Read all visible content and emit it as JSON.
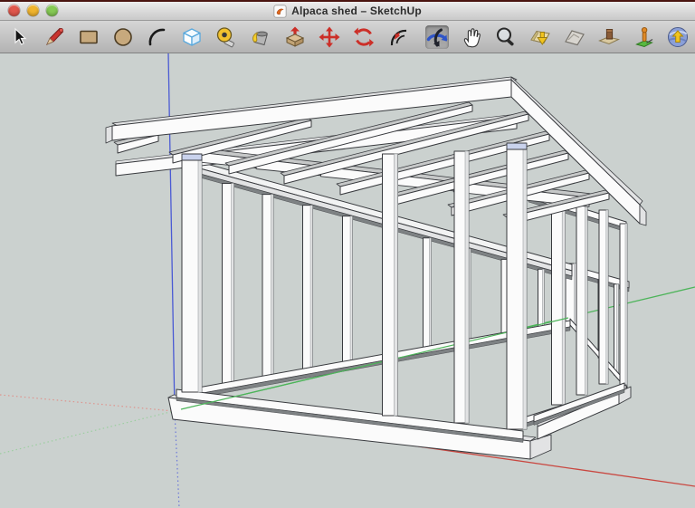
{
  "window": {
    "title": "Alpaca shed – SketchUp",
    "app_icon": "sketchup-document-icon",
    "traffic_lights": [
      {
        "name": "close",
        "color": "#e0574c"
      },
      {
        "name": "minimize",
        "color": "#f0b42e"
      },
      {
        "name": "zoom",
        "color": "#85c954"
      }
    ]
  },
  "toolbar": {
    "tools": [
      {
        "name": "select",
        "active": false
      },
      {
        "name": "line",
        "active": false
      },
      {
        "name": "rectangle",
        "active": false
      },
      {
        "name": "circle",
        "active": false
      },
      {
        "name": "arc",
        "active": false
      },
      {
        "name": "make-component",
        "active": false
      },
      {
        "name": "tape-measure",
        "active": false
      },
      {
        "name": "paint-bucket",
        "active": false
      },
      {
        "name": "push-pull",
        "active": false
      },
      {
        "name": "move",
        "active": false
      },
      {
        "name": "rotate",
        "active": false
      },
      {
        "name": "offset",
        "active": false
      },
      {
        "name": "orbit",
        "active": true
      },
      {
        "name": "pan",
        "active": false
      },
      {
        "name": "zoom",
        "active": false
      },
      {
        "name": "add-location",
        "active": false
      },
      {
        "name": "toggle-terrain",
        "active": false
      },
      {
        "name": "photo-textures",
        "active": false
      },
      {
        "name": "position-camera",
        "active": false
      },
      {
        "name": "preview-google-earth",
        "active": false
      }
    ]
  },
  "viewport": {
    "background": "#cbd1cf",
    "model": {
      "name": "alpaca-shed-framing"
    },
    "axes": {
      "blue_solid": "#4a5ad4",
      "blue_dotted": "#6a76d8",
      "red_solid": "#c94740",
      "red_dotted": "#de948e",
      "green_solid": "#4db45a",
      "green_dotted": "#9ccfa0"
    }
  },
  "colors": {
    "face": "#fbfbfb",
    "face_light": "#f2f3f3",
    "face_shaded": "#e2e3e4",
    "face_top": "#c6c8c8",
    "shadow_band": "#7e8284",
    "edge": "#383a3e",
    "post_cap": "#c9d2ec",
    "screen_top_strip": "#4a1410"
  }
}
